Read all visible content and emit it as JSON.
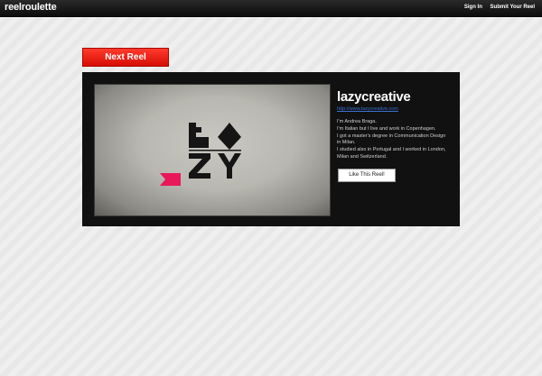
{
  "header": {
    "logo": "reelroulette",
    "links": [
      "Sign In",
      "Submit Your Reel"
    ]
  },
  "next_reel_label": "Next Reel",
  "reel": {
    "title": "lazycreative",
    "url": "http://www.lazycreative.com",
    "bio": [
      "I'm Andrea Braga.",
      "I'm Italian but I live and work in Copenhagen.",
      "I got a master's degree in Communication Design",
      "in Milan.",
      "I studied also in Portugal and I worked in London,",
      "Milan and Switzerland."
    ],
    "like_label": "Like This Reel!"
  },
  "colors": {
    "topbar": "#111111",
    "next_button": "#e8150b",
    "panel": "#111111",
    "link": "#3b6fd0",
    "accent_flag": "#e8185a"
  }
}
